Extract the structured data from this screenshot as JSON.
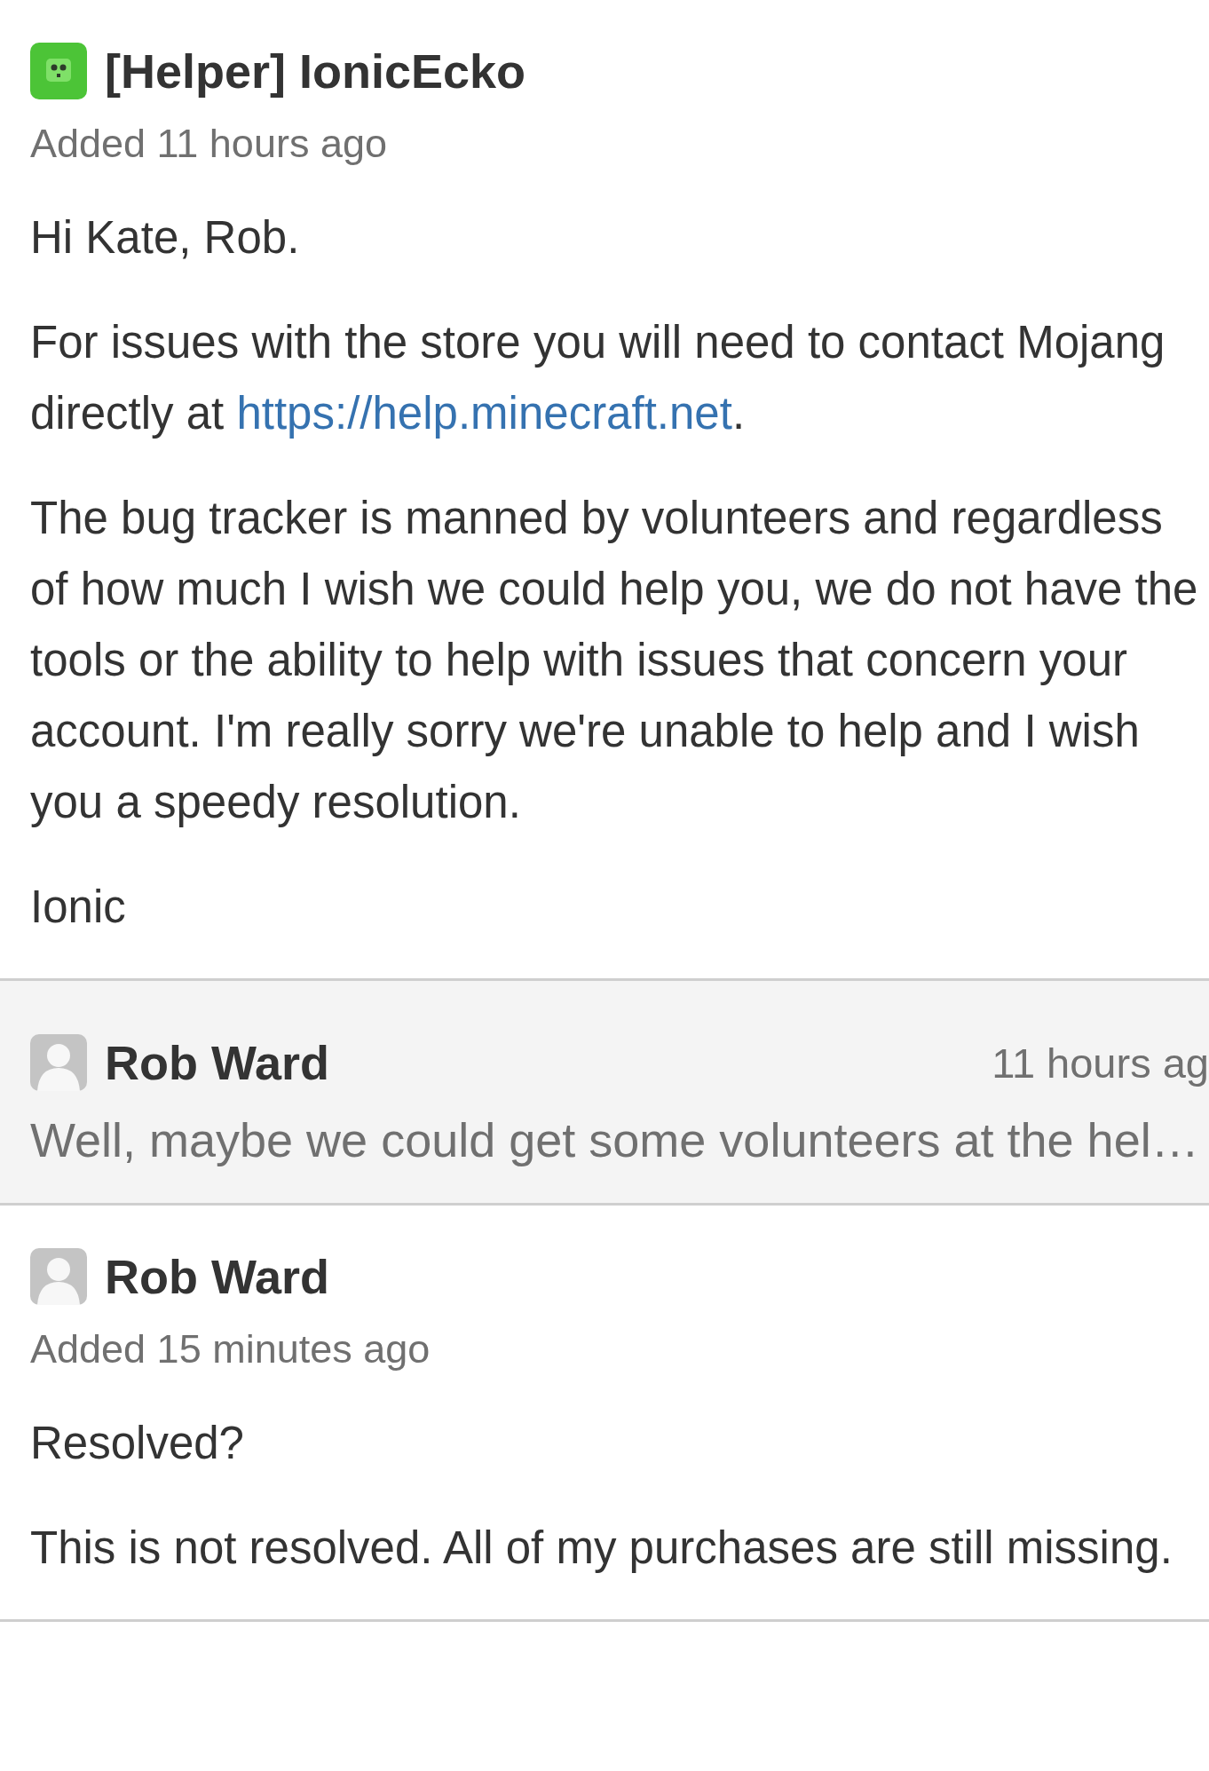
{
  "comments": [
    {
      "kind": "full",
      "avatar": {
        "kind": "helper"
      },
      "author": "[Helper] IonicEcko",
      "meta": "Added 11 hours ago",
      "paragraphs": [
        {
          "text": "Hi Kate, Rob."
        },
        {
          "text": "For issues with the store you will need to contact Mojang directly at ",
          "link": "https://help.minecraft.net",
          "tail": "."
        },
        {
          "text": "The bug tracker is manned by volunteers and regardless of how much I wish we could help you, we do not have the tools or the ability to help with issues that concern your account. I'm really sorry we're unable to help and I wish you a speedy resolution."
        },
        {
          "text": "Ionic"
        }
      ]
    },
    {
      "kind": "collapsed",
      "avatar": {
        "kind": "default"
      },
      "author": "Rob Ward",
      "time": "11 hours ag",
      "preview": "Well, maybe we could get some volunteers at the hel…"
    },
    {
      "kind": "full",
      "avatar": {
        "kind": "default"
      },
      "author": "Rob Ward",
      "meta": "Added 15 minutes ago",
      "paragraphs": [
        {
          "text": "Resolved?"
        },
        {
          "text": "This is not resolved. All of my purchases are still missing."
        }
      ]
    }
  ]
}
